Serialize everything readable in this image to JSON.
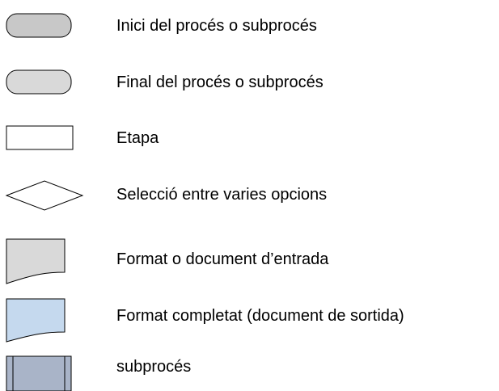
{
  "legend": {
    "items": [
      {
        "symbol": "rounded-rectangle-terminator",
        "fill": "#c8c8c8",
        "label": "Inici del procés o subprocés"
      },
      {
        "symbol": "rounded-rectangle-terminator",
        "fill": "#d9d9d9",
        "label": "Final del procés o subprocés"
      },
      {
        "symbol": "rectangle",
        "fill": "#ffffff",
        "label": "Etapa"
      },
      {
        "symbol": "diamond",
        "fill": "#ffffff",
        "label": "Selecció entre varies opcions"
      },
      {
        "symbol": "document",
        "fill": "#d9d9d9",
        "label": "Format o document d’entrada"
      },
      {
        "symbol": "document",
        "fill": "#c5d9ee",
        "label": "Format completat (document de sortida)"
      },
      {
        "symbol": "predefined-process",
        "fill": "#a9b4c8",
        "label": "subprocés"
      }
    ]
  }
}
